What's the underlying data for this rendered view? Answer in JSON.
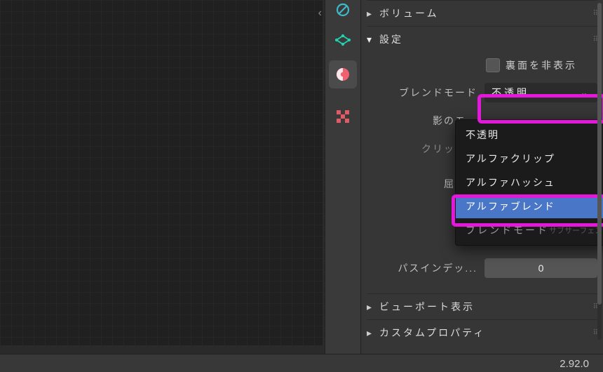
{
  "toolbar_icons": [
    "hidden-circle-icon",
    "mesh-icon",
    "shading-icon",
    "texture-icon"
  ],
  "sections": {
    "volume_label": "ボリューム",
    "settings_label": "設定",
    "viewport_display_label": "ビューポート表示",
    "custom_props_label": "カスタムプロパティ"
  },
  "settings": {
    "backface_culling_label": "裏面を非表示",
    "blend_mode_label": "ブレンドモード",
    "blend_mode_value": "不透明",
    "shadow_mode_label": "影のモー",
    "clip_label": "クリップの",
    "refraction_label": "屈折の",
    "pass_index_label": "パスインデッ...",
    "pass_index_value": "0"
  },
  "dropdown": {
    "options": [
      "不透明",
      "アルファクリップ",
      "アルファハッシュ",
      "アルファブレンド"
    ],
    "footer_label": "ブレンドモード",
    "footer_hint": "サブサーフェスの…",
    "selected": "アルファブレンド"
  },
  "status": {
    "version": "2.92.0"
  }
}
